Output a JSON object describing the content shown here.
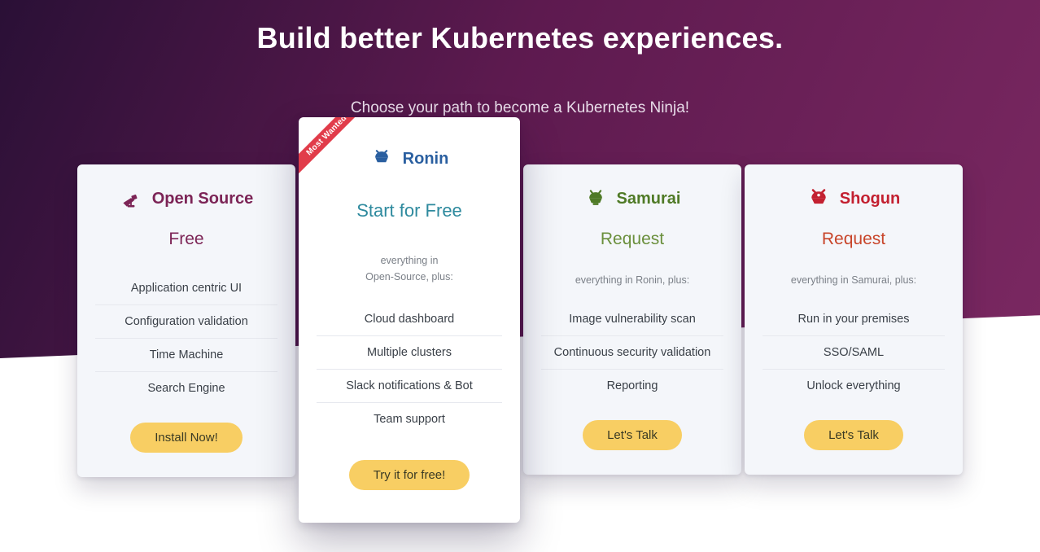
{
  "header": {
    "title": "Build better Kubernetes experiences.",
    "subtitle": "Choose your path to become a Kubernetes Ninja!"
  },
  "ribbon": "Most Wanted",
  "tiers": [
    {
      "name": "Open Source",
      "price": "Free",
      "lead1": "",
      "lead2": "",
      "features": [
        "Application centric UI",
        "Configuration validation",
        "Time Machine",
        "Search Engine"
      ],
      "cta": "Install Now!"
    },
    {
      "name": "Ronin",
      "price": "Start for Free",
      "lead1": "everything in",
      "lead2": "Open-Source, plus:",
      "features": [
        "Cloud dashboard",
        "Multiple clusters",
        "Slack notifications & Bot",
        "Team support"
      ],
      "cta": "Try it for free!"
    },
    {
      "name": "Samurai",
      "price": "Request",
      "lead1": "everything in Ronin, plus:",
      "lead2": "",
      "features": [
        "Image vulnerability scan",
        "Continuous security validation",
        "Reporting"
      ],
      "cta": "Let's Talk"
    },
    {
      "name": "Shogun",
      "price": "Request",
      "lead1": "everything in Samurai, plus:",
      "lead2": "",
      "features": [
        "Run in your premises",
        "SSO/SAML",
        "Unlock everything"
      ],
      "cta": "Let's Talk"
    }
  ]
}
